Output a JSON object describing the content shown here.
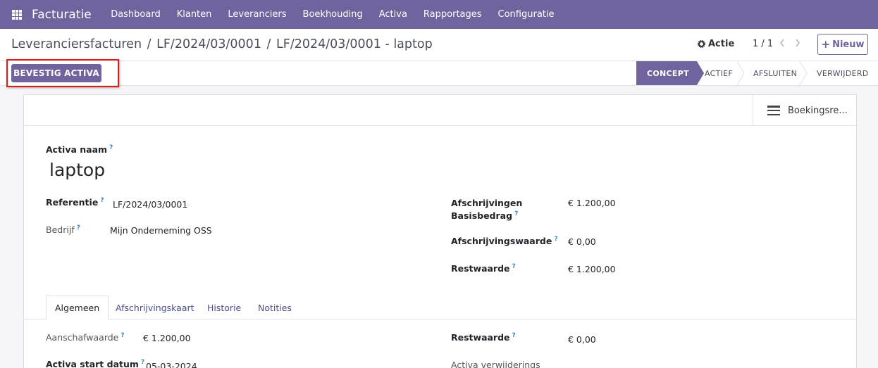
{
  "navbar": {
    "brand": "Facturatie",
    "menu": [
      "Dashboard",
      "Klanten",
      "Leveranciers",
      "Boekhouding",
      "Activa",
      "Rapportages",
      "Configuratie"
    ]
  },
  "control": {
    "breadcrumb": [
      "Leveranciersfacturen",
      "LF/2024/03/0001",
      "LF/2024/03/0001 - laptop"
    ],
    "breadcrumb_sep": "/",
    "action_label": "Actie",
    "pager": "1 / 1",
    "new_label": "Nieuw"
  },
  "statusbar": {
    "confirm_label": "BEVESTIG ACTIVA",
    "stages": [
      "CONCEPT",
      "ACTIEF",
      "AFSLUITEN",
      "VERWIJDERD"
    ],
    "active_stage": "CONCEPT"
  },
  "sheet": {
    "smart_button": "Boekingsre...",
    "name_label": "Activa naam",
    "name_value": "laptop",
    "help_mark": "?",
    "left_fields": [
      {
        "label": "Referentie",
        "value": "LF/2024/03/0001"
      },
      {
        "label": "Bedrijf",
        "value": "Mijn Onderneming OSS"
      }
    ],
    "right_fields": [
      {
        "label_line1": "Afschrijvingen",
        "label_line2": "Basisbedrag",
        "value": "€ 1.200,00"
      },
      {
        "label": "Afschrijvingswaarde",
        "value": "€ 0,00"
      },
      {
        "label": "Restwaarde",
        "value": "€ 1.200,00"
      }
    ],
    "tabs": [
      "Algemeen",
      "Afschrijvingskaart",
      "Historie",
      "Notities"
    ],
    "tab_fields": {
      "left": [
        {
          "label": "Aanschafwaarde",
          "value": "€ 1.200,00"
        },
        {
          "label": "Activa start datum",
          "value": "05-03-2024"
        }
      ],
      "right": [
        {
          "label": "Restwaarde",
          "value": "€ 0,00"
        },
        {
          "label": "Activa verwijderings"
        }
      ]
    }
  },
  "colors": {
    "brand": "#71639e",
    "highlight": "#e01b1b"
  }
}
